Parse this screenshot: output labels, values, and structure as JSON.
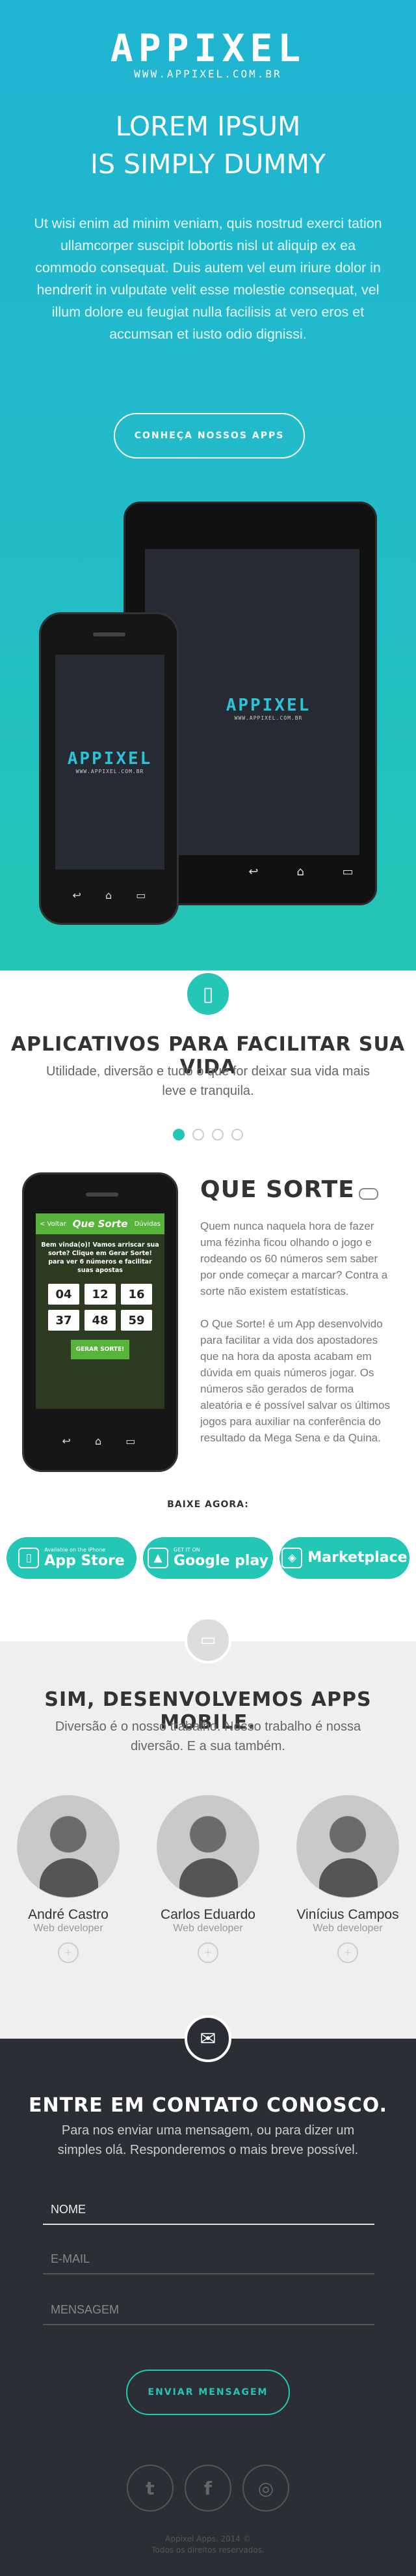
{
  "brand": {
    "logo": "APPIXEL",
    "url": "WWW.APPIXEL.COM.BR",
    "accent": "#24c6b5",
    "dark": "#2b2f35"
  },
  "hero": {
    "title_line1": "LOREM IPSUM",
    "title_line2": "IS SIMPLY DUMMY",
    "text": "Ut wisi enim ad minim veniam, quis nostrud exerci tation ullamcorper suscipit lobortis nisl ut aliquip ex ea commodo consequat. Duis autem vel eum iriure dolor in hendrerit in vulputate velit esse molestie consequat, vel illum dolore eu feugiat nulla facilisis at vero eros et accumsan et iusto odio dignissi.",
    "button": "CONHEÇA NOSSOS APPS"
  },
  "devices": {
    "screen_logo": "APPIXEL",
    "screen_url": "WWW.APPIXEL.COM.BR"
  },
  "apps_section": {
    "icon": "mobile-phone-icon",
    "title": "APLICATIVOS PARA FACILITAR SUA VIDA",
    "subtitle": "Utilidade, diversão e tudo o que for deixar sua vida mais leve e tranquila.",
    "carousel_count": 4,
    "carousel_active": 1
  },
  "app": {
    "name": "QUE SORTE",
    "icon": "gamepad-icon",
    "desc1": "Quem nunca naquela hora de fazer uma fézinha ficou olhando o jogo e rodeando os 60 números sem saber por onde começar a marcar? Contra a sorte não existem estatísticas.",
    "desc2": "O Que Sorte! é um App desenvolvido para facilitar a vida dos apostadores que na hora da aposta acabam em dúvida em quais números jogar. Os números são gerados de forma aleatória e é possível salvar os últimos jogos para auxiliar na conferência do resultado da Mega Sena e da Quina.",
    "screen": {
      "back": "< Voltar",
      "title": "Que Sorte",
      "right": "Dúvidas",
      "message": "Bem vinda(o)! Vamos arriscar sua sorte? Clique em Gerar Sorte! para ver 6 números e facilitar suas apostas",
      "numbers": [
        "04",
        "12",
        "16",
        "37",
        "48",
        "59"
      ],
      "button": "GERAR SORTE!"
    }
  },
  "download": {
    "label": "BAIXE AGORA:",
    "stores": [
      {
        "small": "Available on the iPhone",
        "big": "App Store",
        "icon": "apple-icon"
      },
      {
        "small": "GET IT ON",
        "big": "Google play",
        "icon": "android-icon"
      },
      {
        "small": "",
        "big": "Marketplace",
        "icon": "windows-store-icon"
      }
    ]
  },
  "team": {
    "icon": "briefcase-icon",
    "title": "SIM, DESENVOLVEMOS APPS MOBILE.",
    "subtitle": "Diversão é o nosso trabalho. Nosso trabalho é nossa diversão. E a sua também.",
    "members": [
      {
        "name": "André Castro",
        "role": "Web developer"
      },
      {
        "name": "Carlos Eduardo",
        "role": "Web developer"
      },
      {
        "name": "Vinícius Campos",
        "role": "Web developer"
      }
    ]
  },
  "contact": {
    "icon": "envelope-icon",
    "title": "ENTRE EM CONTATO CONOSCO.",
    "subtitle": "Para nos enviar uma mensagem, ou para dizer um simples olá. Responderemos o mais breve possível.",
    "name_placeholder": "NOME",
    "email_placeholder": "E-MAIL",
    "message_placeholder": "MENSAGEM",
    "button": "ENVIAR MENSAGEM",
    "social": [
      {
        "name": "twitter-icon",
        "glyph": "t"
      },
      {
        "name": "facebook-icon",
        "glyph": "f"
      },
      {
        "name": "instagram-icon",
        "glyph": "◎"
      }
    ]
  },
  "footer": {
    "line1": "Appixel Apps. 2014 ©",
    "line2": "Todos os direitos reservados."
  }
}
